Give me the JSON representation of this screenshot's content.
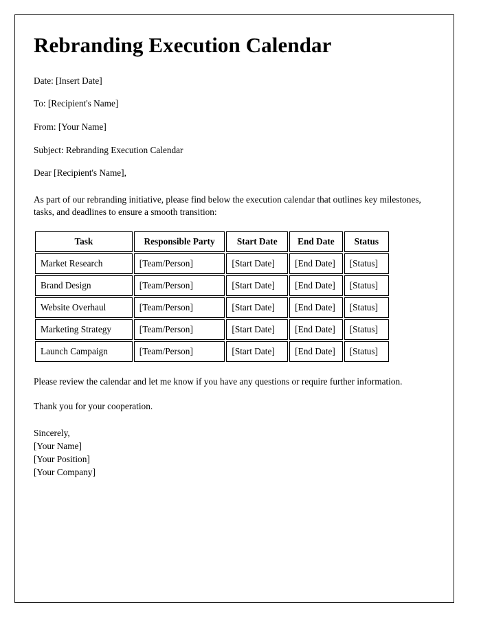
{
  "document": {
    "title": "Rebranding Execution Calendar",
    "meta_lines": [
      "Date: [Insert Date]",
      "To: [Recipient's Name]",
      "From: [Your Name]",
      "Subject: Rebranding Execution Calendar"
    ],
    "salutation": "Dear [Recipient's Name],",
    "intro_paragraph": "As part of our rebranding initiative, please find below the execution calendar that outlines key milestones, tasks, and deadlines to ensure a smooth transition:",
    "table": {
      "headers": [
        "Task",
        "Responsible Party",
        "Start Date",
        "End Date",
        "Status"
      ],
      "rows": [
        [
          "Market Research",
          "[Team/Person]",
          "[Start Date]",
          "[End Date]",
          "[Status]"
        ],
        [
          "Brand Design",
          "[Team/Person]",
          "[Start Date]",
          "[End Date]",
          "[Status]"
        ],
        [
          "Website Overhaul",
          "[Team/Person]",
          "[Start Date]",
          "[End Date]",
          "[Status]"
        ],
        [
          "Marketing Strategy",
          "[Team/Person]",
          "[Start Date]",
          "[End Date]",
          "[Status]"
        ],
        [
          "Launch Campaign",
          "[Team/Person]",
          "[Start Date]",
          "[End Date]",
          "[Status]"
        ]
      ]
    },
    "closing_paragraph": "Please review the calendar and let me know if you have any questions or require further information.",
    "thanks_paragraph": "Thank you for your cooperation.",
    "signature_lines": [
      "Sincerely,",
      "[Your Name]",
      "[Your Position]",
      "[Your Company]"
    ]
  },
  "colors": {
    "page_background": "#ffffff",
    "text": "#000000",
    "border": "#1a1a1a",
    "table_border": "#000000"
  }
}
